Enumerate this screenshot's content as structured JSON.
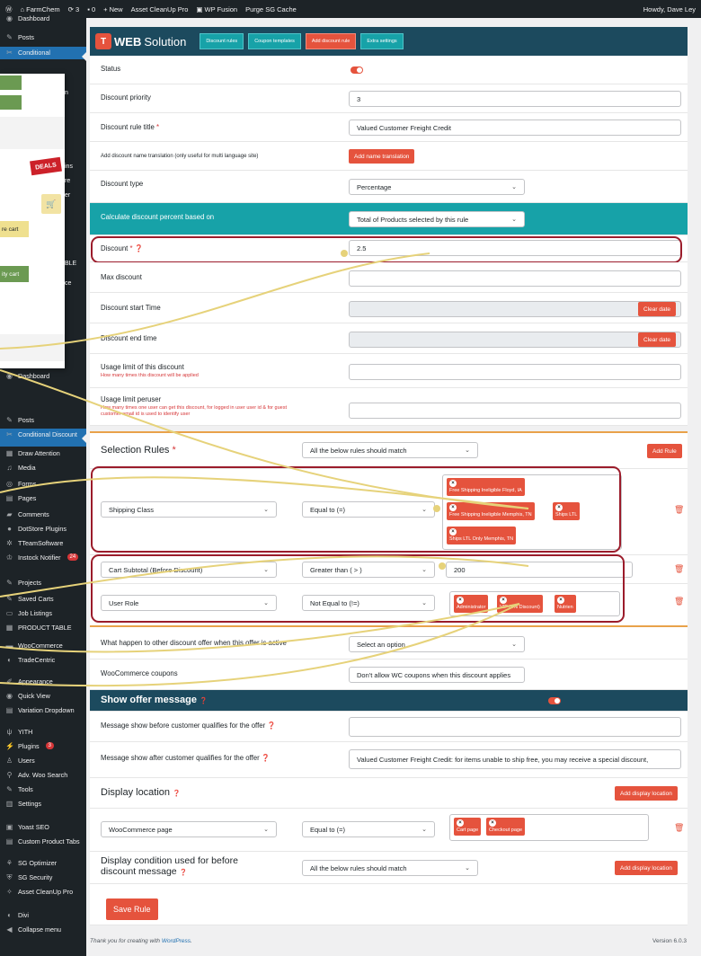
{
  "adminbar": {
    "site": "FarmChem",
    "updates": "3",
    "comments": "0",
    "new": "New",
    "cleanup": "Asset CleanUp Pro",
    "fusion": "WP Fusion",
    "purge": "Purge SG Cache",
    "howdy": "Howdy, Dave Ley"
  },
  "sidebar": [
    {
      "label": "Dashboard",
      "icon": "dashboard-icon"
    },
    {
      "label": "Posts",
      "icon": "pin-icon"
    },
    {
      "label": "Conditional",
      "icon": "discount-icon"
    },
    {
      "label": "Dashboard",
      "icon": "dashboard-icon"
    },
    {
      "label": "Posts",
      "icon": "pin-icon"
    },
    {
      "label": "Conditional Discount",
      "icon": "discount-icon"
    },
    {
      "label": "Draw Attention",
      "icon": "image-icon"
    },
    {
      "label": "Media",
      "icon": "media-icon"
    },
    {
      "label": "Forms",
      "icon": "forms-icon"
    },
    {
      "label": "Pages",
      "icon": "pages-icon"
    },
    {
      "label": "Comments",
      "icon": "comment-icon"
    },
    {
      "label": "DotStore Plugins",
      "icon": "dotstore-icon"
    },
    {
      "label": "TTeamSoftware",
      "icon": "gear-icon"
    },
    {
      "label": "Instock Notifier",
      "icon": "bell-icon",
      "badge": "24"
    },
    {
      "label": "Projects",
      "icon": "pin-icon"
    },
    {
      "label": "Saved Carts",
      "icon": "pin-icon"
    },
    {
      "label": "Job Listings",
      "icon": "briefcase-icon"
    },
    {
      "label": "PRODUCT TABLE",
      "icon": "table-icon"
    },
    {
      "label": "WooCommerce",
      "icon": "woo-icon"
    },
    {
      "label": "TradeCentric",
      "icon": "trade-icon"
    },
    {
      "label": "Appearance",
      "icon": "brush-icon"
    },
    {
      "label": "Quick View",
      "icon": "eye-icon"
    },
    {
      "label": "Variation Dropdown",
      "icon": "dropdown-icon"
    },
    {
      "label": "YITH",
      "icon": "yith-icon"
    },
    {
      "label": "Plugins",
      "icon": "plug-icon",
      "badge": "3"
    },
    {
      "label": "Users",
      "icon": "user-icon"
    },
    {
      "label": "Adv. Woo Search",
      "icon": "search-icon"
    },
    {
      "label": "Tools",
      "icon": "wrench-icon"
    },
    {
      "label": "Settings",
      "icon": "settings-icon"
    },
    {
      "label": "Yoast SEO",
      "icon": "yoast-icon"
    },
    {
      "label": "Custom Product Tabs",
      "icon": "tabs-icon"
    },
    {
      "label": "SG Optimizer",
      "icon": "sg-icon"
    },
    {
      "label": "SG Security",
      "icon": "shield-icon"
    },
    {
      "label": "Asset CleanUp Pro",
      "icon": "cleanup-icon"
    },
    {
      "label": "Divi",
      "icon": "divi-icon"
    },
    {
      "label": "Collapse menu",
      "icon": "collapse-icon"
    }
  ],
  "header": {
    "logo_mark": "T",
    "logo_web": "WEB",
    "logo_sol": "Solution",
    "tabs": [
      "Discount rules",
      "Coupon templates",
      "Add discount rule",
      "Extra settings"
    ]
  },
  "form": {
    "status": "Status",
    "priority_label": "Discount priority",
    "priority_value": "3",
    "title_label": "Discount rule title",
    "title_req": "*",
    "title_value": "Valued Customer Freight Credit",
    "translation_label": "Add discount name translation (only useful for multi language site)",
    "translation_btn": "Add name translation",
    "type_label": "Discount type",
    "type_value": "Percentage",
    "calc_label": "Calculate discount percent based on",
    "calc_value": "Total of Products selected by this rule",
    "discount_label": "Discount",
    "discount_req": "*",
    "discount_value": "2.5",
    "max_label": "Max discount",
    "start_label": "Discount start Time",
    "clear1": "Clear date",
    "end_label": "Discount end time",
    "clear2": "Clear date",
    "limit_label": "Usage limit of this discount",
    "limit_sub": "How many times this discount will be applied",
    "peruser_label": "Usage limit peruser",
    "peruser_sub1": "How many times one user can get this discount, for logged in user user id & for guest",
    "peruser_sub2": "customer email id is used to identify user"
  },
  "selection": {
    "title": "Selection Rules",
    "req": "*",
    "match": "All the below rules should match",
    "add_rule": "Add Rule",
    "rule1_field": "Shipping Class",
    "rule1_op": "Equal to (=)",
    "rule1_tags": [
      "Free Shipping Ineligible Floyd, IA",
      "Free Shipping Ineligible Memphis, TN",
      "Ships LTL",
      "Ships LTL Only Memphis, TN"
    ],
    "rule2_field": "Cart Subtotal (Before Discount)",
    "rule2_op": "Greater than ( > )",
    "rule2_value": "200",
    "rule3_field": "User Role",
    "rule3_op": "Not Equal to (!=)",
    "rule3_tags": [
      "Administrator",
      "VIP (5% Discount)",
      "Nutrien"
    ]
  },
  "other": {
    "happen_label": "What happen to other discount offer when this offer is active",
    "happen_value": "Select an option",
    "coupons_label": "WooCommerce coupons",
    "coupons_value": "Don't allow WC coupons when this discount applies"
  },
  "offer": {
    "title": "Show offer message",
    "before_label": "Message show before customer qualifies for the offer",
    "after_label": "Message show after customer qualifies for the offer",
    "after_value": "Valued Customer Freight Credit: for items unable to ship free, you may receive a special discount,"
  },
  "location": {
    "title": "Display location",
    "add_btn": "Add display location",
    "page_field": "WooCommerce page",
    "page_op": "Equal to (=)",
    "tags": [
      "Cart page",
      "Checkout page"
    ]
  },
  "condition": {
    "title1": "Display condition used for before",
    "title2": "discount message",
    "match": "All the below rules should match",
    "add_btn": "Add display location"
  },
  "save": "Save Rule",
  "footer": {
    "thanks": "Thank you for creating with ",
    "wp": "WordPress",
    "end": ".",
    "version": "Version 6.0.3"
  },
  "popup": {
    "deals": "DEALS",
    "cart1": "re cart",
    "cart2": "ity cart",
    "frag": [
      "n",
      "ins",
      "re",
      "er",
      "BLE",
      "ce"
    ]
  },
  "colors": {
    "accent": "#e5533d",
    "teal": "#17a2a8",
    "navy": "#1c4a5e",
    "highlight": "#9b1c2b",
    "callout": "#e6d27a"
  }
}
